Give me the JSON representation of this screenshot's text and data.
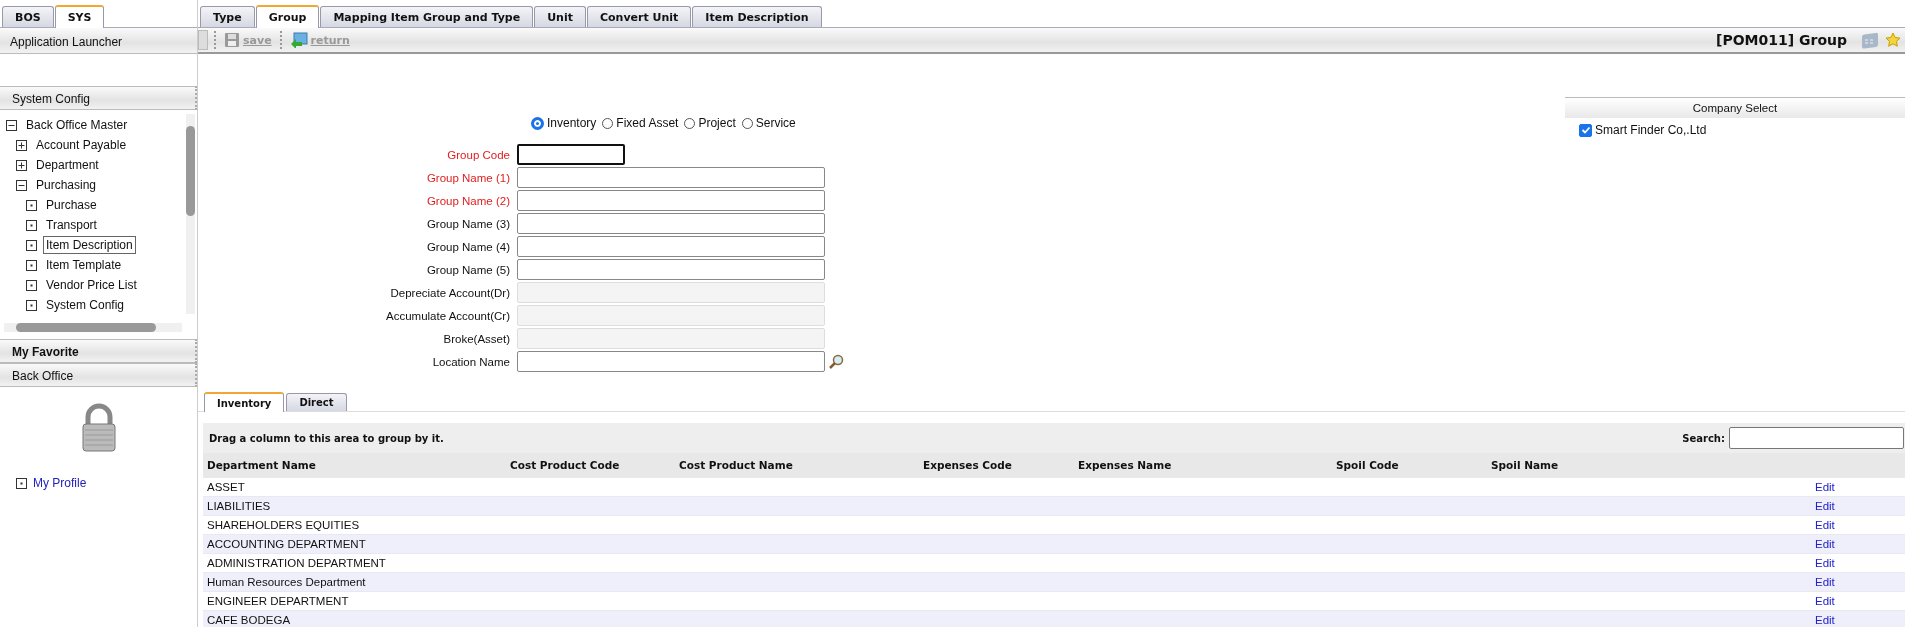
{
  "sidebar": {
    "tabs": [
      {
        "label": "BOS",
        "selected": false
      },
      {
        "label": "SYS",
        "selected": true
      }
    ],
    "launcher": "Application Launcher",
    "system_config": {
      "title": "System Config",
      "tree": [
        {
          "label": "Back Office Master",
          "expanded": true,
          "selected": false,
          "children": [
            {
              "label": "Account Payable",
              "expanded": false,
              "selected": false
            },
            {
              "label": "Department",
              "expanded": false,
              "selected": false
            },
            {
              "label": "Purchasing",
              "expanded": true,
              "selected": false,
              "children": [
                {
                  "label": "Purchase",
                  "selected": false
                },
                {
                  "label": "Transport",
                  "selected": false
                },
                {
                  "label": "Item Description",
                  "selected": true
                },
                {
                  "label": "Item Template",
                  "selected": false
                },
                {
                  "label": "Vendor Price List",
                  "selected": false
                },
                {
                  "label": "System Config",
                  "selected": false
                }
              ]
            }
          ]
        }
      ]
    },
    "my_favorite": "My Favorite",
    "back_office": {
      "title": "Back Office",
      "links": [
        "My Profile"
      ]
    }
  },
  "tabs": [
    {
      "label": "Type",
      "selected": false
    },
    {
      "label": "Group",
      "selected": true
    },
    {
      "label": "Mapping Item Group and Type",
      "selected": false
    },
    {
      "label": "Unit",
      "selected": false
    },
    {
      "label": "Convert Unit",
      "selected": false
    },
    {
      "label": "Item Description",
      "selected": false
    }
  ],
  "toolbar": {
    "buttons": [
      {
        "kind": "save",
        "label": "save",
        "disabled": true
      },
      {
        "kind": "return",
        "label": "return",
        "disabled": true
      }
    ],
    "title": "[POM011] Group"
  },
  "form": {
    "types": [
      {
        "label": "Inventory",
        "selected": true
      },
      {
        "label": "Fixed Asset",
        "selected": false
      },
      {
        "label": "Project",
        "selected": false
      },
      {
        "label": "Service",
        "selected": false
      }
    ],
    "fields": [
      {
        "label": "Group Code",
        "required": true,
        "disabled": false,
        "kind": "short"
      },
      {
        "label": "Group Name (1)",
        "required": true,
        "disabled": false,
        "kind": "text"
      },
      {
        "label": "Group Name (2)",
        "required": true,
        "disabled": false,
        "kind": "text"
      },
      {
        "label": "Group Name (3)",
        "required": false,
        "disabled": false,
        "kind": "text"
      },
      {
        "label": "Group Name (4)",
        "required": false,
        "disabled": false,
        "kind": "text"
      },
      {
        "label": "Group Name (5)",
        "required": false,
        "disabled": false,
        "kind": "text"
      },
      {
        "label": "Depreciate Account(Dr)",
        "required": false,
        "disabled": true,
        "kind": "text"
      },
      {
        "label": "Accumulate Account(Cr)",
        "required": false,
        "disabled": true,
        "kind": "text"
      },
      {
        "label": "Broke(Asset)",
        "required": false,
        "disabled": true,
        "kind": "text"
      },
      {
        "label": "Location Name",
        "required": false,
        "disabled": false,
        "kind": "lookup"
      }
    ]
  },
  "company_select": {
    "title": "Company Select",
    "companies": [
      {
        "label": "Smart Finder Co,.Ltd",
        "checked": true
      }
    ]
  },
  "grid_tabs": [
    {
      "label": "Inventory",
      "selected": true
    },
    {
      "label": "Direct",
      "selected": false
    }
  ],
  "grid": {
    "group_hint": "Drag a column to this area to group by it.",
    "search_label": "Search:",
    "columns": [
      "Department Name",
      "Cost Product Code",
      "Cost Product Name",
      "Expenses Code",
      "Expenses Name",
      "Spoil Code",
      "Spoil Name"
    ],
    "rows": [
      {
        "department_name": "ASSET",
        "action": "Edit"
      },
      {
        "department_name": "LIABILITIES",
        "action": "Edit"
      },
      {
        "department_name": "SHAREHOLDERS EQUITIES",
        "action": "Edit"
      },
      {
        "department_name": "ACCOUNTING DEPARTMENT",
        "action": "Edit"
      },
      {
        "department_name": "ADMINISTRATION DEPARTMENT",
        "action": "Edit"
      },
      {
        "department_name": "Human Resources Department",
        "action": "Edit"
      },
      {
        "department_name": "ENGINEER DEPARTMENT",
        "action": "Edit"
      },
      {
        "department_name": "CAFE BODEGA",
        "action": "Edit"
      }
    ]
  }
}
